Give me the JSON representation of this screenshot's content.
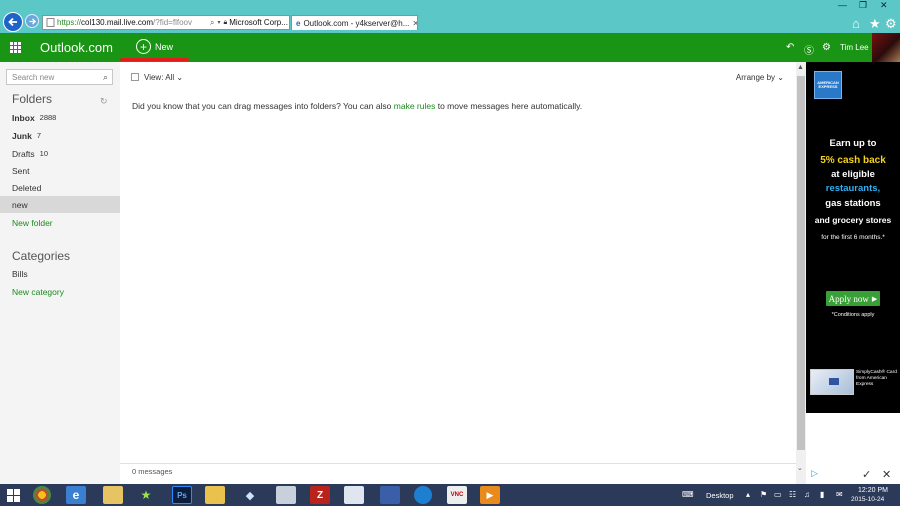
{
  "browser": {
    "address": {
      "secure": "https://",
      "host": "col130.mail.live.com",
      "rest": "/?fid=flfoov"
    },
    "tabs": [
      {
        "label": "Microsoft Corp..."
      },
      {
        "label": "Outlook.com - y4kserver@h..."
      }
    ]
  },
  "header": {
    "brand": "Outlook.com",
    "new_label": "New",
    "user_name": "Tim Lee"
  },
  "sidebar": {
    "search_placeholder": "Search new",
    "folders_title": "Folders",
    "folders": [
      {
        "label": "Inbox",
        "count": "2888"
      },
      {
        "label": "Junk",
        "count": "7"
      },
      {
        "label": "Drafts",
        "count": "10"
      },
      {
        "label": "Sent"
      },
      {
        "label": "Deleted"
      },
      {
        "label": "new"
      }
    ],
    "new_folder": "New folder",
    "categories_title": "Categories",
    "categories": [
      {
        "label": "Bills"
      }
    ],
    "new_category": "New category"
  },
  "main": {
    "view_label": "View: All",
    "arrange_label": "Arrange by",
    "tip_before": "Did you know that you can drag messages into folders? You can also ",
    "tip_link": "make rules",
    "tip_after": " to move messages here automatically.",
    "message_count": "0 messages"
  },
  "ad": {
    "logo_text": "AMERICAN EXPRESS",
    "line1": "Earn up to",
    "line2": "5% cash back",
    "line3": "at eligible",
    "line4": "restaurants,",
    "line5": "gas stations",
    "line6": "and grocery stores",
    "line7": "for the first 6 months.*",
    "apply_label": "Apply now",
    "conditions": "*Conditions apply",
    "card_text": "SimplyCash® Card from American Express"
  },
  "taskbar": {
    "desktop_label": "Desktop",
    "time": "12:20 PM",
    "date": "2015-10-24"
  },
  "colors": {
    "chrome_bg": "#5bc7c7",
    "outlook_green": "#199414",
    "link_green": "#1a8c1a",
    "ad_yellow": "#f5d21c",
    "ad_blue": "#2fb0f0",
    "taskbar_bg": "#2b3a58",
    "annotation_red": "#e21b1b"
  }
}
